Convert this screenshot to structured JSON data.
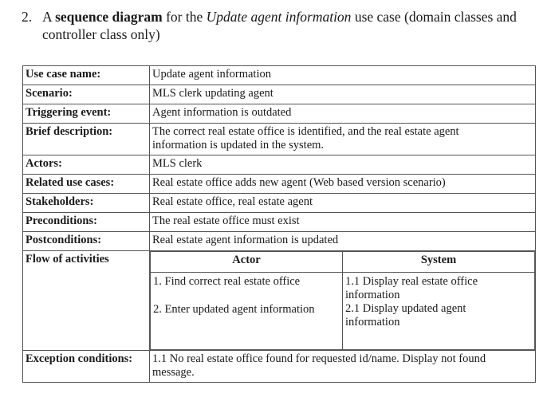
{
  "heading": {
    "number": "2.",
    "prefix": "A ",
    "bold": "sequence diagram",
    "middle": " for the ",
    "italic": "Update agent information",
    "suffix": " use case (domain classes and controller class only)"
  },
  "use_case": {
    "rows": [
      {
        "label": "Use case name:",
        "value": "Update agent information"
      },
      {
        "label": "Scenario:",
        "value": "MLS clerk updating agent"
      },
      {
        "label": "Triggering event:",
        "value": "Agent information is outdated"
      },
      {
        "label": "Brief description:",
        "value": "The correct real estate office is identified, and the real estate agent information is updated in the system."
      },
      {
        "label": "Actors:",
        "value": "MLS clerk"
      },
      {
        "label": "Related use cases:",
        "value": "Real estate office adds new agent (Web based version scenario)"
      },
      {
        "label": "Stakeholders:",
        "value": "Real estate office, real estate agent"
      },
      {
        "label": "Preconditions:",
        "value": "The real estate office must exist"
      },
      {
        "label": "Postconditions:",
        "value": "Real estate agent information is updated"
      }
    ],
    "flow": {
      "label": "Flow of activities",
      "actor_header": "Actor",
      "system_header": "System",
      "actor_steps": [
        "1. Find correct real estate office",
        "2. Enter updated agent information"
      ],
      "system_steps": [
        "1.1 Display real estate office information",
        "2.1 Display updated agent information"
      ]
    },
    "exception": {
      "label": "Exception conditions:",
      "value": "1.1 No real estate office found for requested id/name. Display not found message."
    }
  }
}
